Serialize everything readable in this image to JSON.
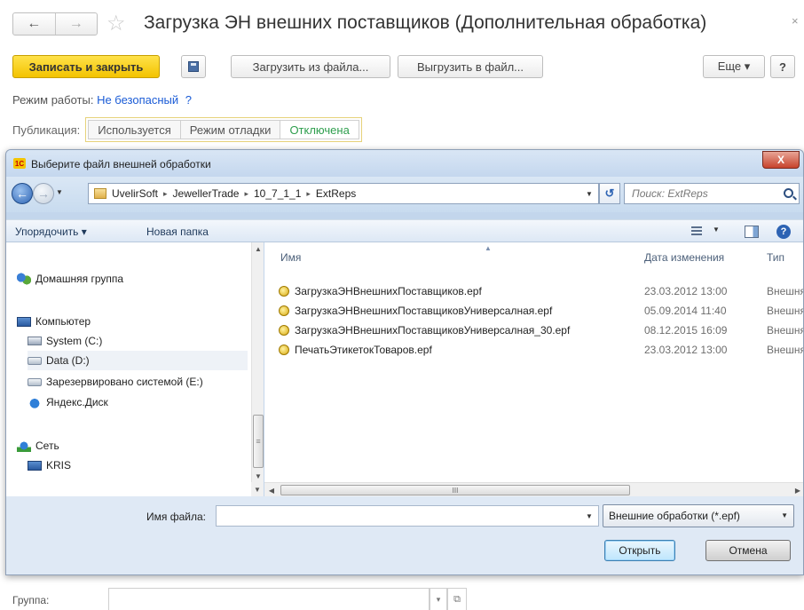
{
  "form": {
    "title": "Загрузка ЭН внешних поставщиков (Дополнительная обработка)",
    "back_glyph": "←",
    "forward_glyph": "→",
    "star_glyph": "☆",
    "close_glyph": "×"
  },
  "toolbar": {
    "save_close_label": "Записать и закрыть",
    "load_from_file_label": "Загрузить из файла...",
    "export_to_file_label": "Выгрузить в файл...",
    "more_label": "Еще ▾",
    "help_label": "?"
  },
  "mode": {
    "label": "Режим работы:",
    "value": "Не безопасный",
    "help": "?"
  },
  "publication": {
    "label": "Публикация:",
    "options": [
      "Используется",
      "Режим отладки",
      "Отключена"
    ],
    "selected": "Отключена"
  },
  "group_field": {
    "label": "Группа:",
    "value": "",
    "dropdown_glyph": "▾",
    "open_glyph": "⧉"
  },
  "dialog": {
    "title": "Выберите файл внешней обработки",
    "logo_text": "1С",
    "close_glyph": "X",
    "path": [
      "UvelirSoft",
      "JewellerTrade",
      "10_7_1_1",
      "ExtReps"
    ],
    "path_separator": "▸",
    "search_placeholder": "Поиск: ExtReps",
    "commands": {
      "organize": "Упорядочить ▾",
      "new_folder": "Новая папка"
    },
    "nav_items": [
      {
        "label": "Домашняя группа",
        "icon": "homegroup-icon"
      },
      {
        "label": "Компьютер",
        "icon": "computer-icon"
      },
      {
        "label": "System (C:)",
        "icon": "system-drive-icon"
      },
      {
        "label": "Data (D:)",
        "icon": "drive-icon",
        "selected": true
      },
      {
        "label": "Зарезервировано системой (E:)",
        "icon": "drive-icon"
      },
      {
        "label": "Яндекс.Диск",
        "icon": "yandex-disk-icon"
      },
      {
        "label": "Сеть",
        "icon": "network-icon"
      },
      {
        "label": "KRIS",
        "icon": "computer-icon"
      }
    ],
    "columns": {
      "name": "Имя",
      "date": "Дата изменения",
      "type": "Тип"
    },
    "files": [
      {
        "name": "ЗагрузкаЭНВнешнихПоставщиков.epf",
        "date": "23.03.2012 13:00",
        "type": "Внешня"
      },
      {
        "name": "ЗагрузкаЭНВнешнихПоставщиковУниверсалная.epf",
        "date": "05.09.2014 11:40",
        "type": "Внешня"
      },
      {
        "name": "ЗагрузкаЭНВнешнихПоставщиковУниверсалная_30.epf",
        "date": "08.12.2015 16:09",
        "type": "Внешня"
      },
      {
        "name": "ПечатьЭтикетокТоваров.epf",
        "date": "23.03.2012 13:00",
        "type": "Внешня"
      }
    ],
    "filename_label": "Имя файла:",
    "filename_value": "",
    "filter": "Внешние обработки (*.epf)",
    "open_label": "Открыть",
    "cancel_label": "Отмена",
    "scroll_grip": "III",
    "vgrip": "≡"
  }
}
